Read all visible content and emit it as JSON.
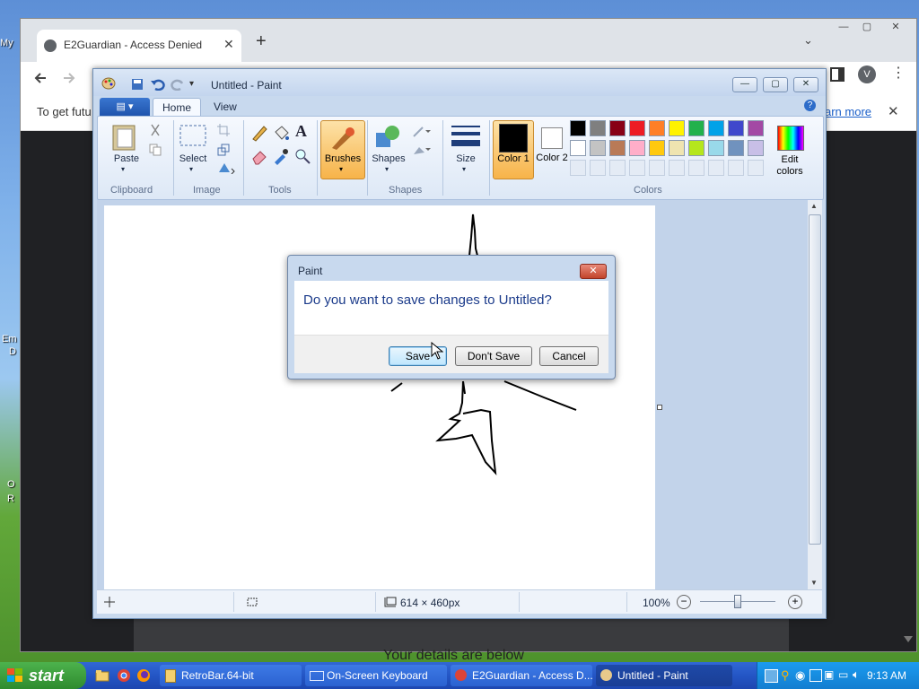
{
  "desktop": {
    "icon_labels": [
      "My",
      "Em",
      "D",
      "O",
      "R"
    ]
  },
  "chrome": {
    "tab_title": "E2Guardian - Access Denied",
    "tab_close": "✕",
    "new_tab": "+",
    "tab_menu": "⌄",
    "window_buttons": [
      "—",
      "▢",
      "✕"
    ],
    "infobar_text": "To get futu",
    "infobar_link": "arn more",
    "infobar_close": "✕",
    "avatar_letter": "V",
    "page_text": "Your details are below"
  },
  "paint": {
    "title": "Untitled - Paint",
    "window_buttons": [
      "—",
      "▢",
      "✕"
    ],
    "tabs": {
      "home": "Home",
      "view": "View"
    },
    "groups": {
      "clipboard": "Clipboard",
      "image": "Image",
      "tools": "Tools",
      "shapes": "Shapes",
      "colors": "Colors"
    },
    "buttons": {
      "paste": "Paste",
      "select": "Select",
      "brushes": "Brushes",
      "shapes": "Shapes",
      "size": "Size",
      "color1": "Color 1",
      "color2": "Color 2",
      "edit_colors": "Edit colors"
    },
    "palette_row1": [
      "#000000",
      "#7f7f7f",
      "#880015",
      "#ed1c24",
      "#ff7f27",
      "#fff200",
      "#22b14c",
      "#00a2e8",
      "#3f48cc",
      "#a349a4"
    ],
    "palette_row2": [
      "#ffffff",
      "#c3c3c3",
      "#b97a57",
      "#ffaec9",
      "#ffc90e",
      "#efe4b0",
      "#b5e61d",
      "#99d9ea",
      "#7092be",
      "#c8bfe7"
    ],
    "color1_value": "#000000",
    "color2_value": "#ffffff",
    "status": {
      "size": "614 × 460px",
      "zoom": "100%"
    }
  },
  "dialog": {
    "title": "Paint",
    "message": "Do you want to save changes to Untitled?",
    "save": "Save",
    "dont_save": "Don't Save",
    "cancel": "Cancel"
  },
  "taskbar": {
    "start": "start",
    "items": [
      "RetroBar.64-bit",
      "On-Screen Keyboard",
      "E2Guardian - Access D...",
      "Untitled - Paint"
    ],
    "clock": "9:13 AM"
  }
}
